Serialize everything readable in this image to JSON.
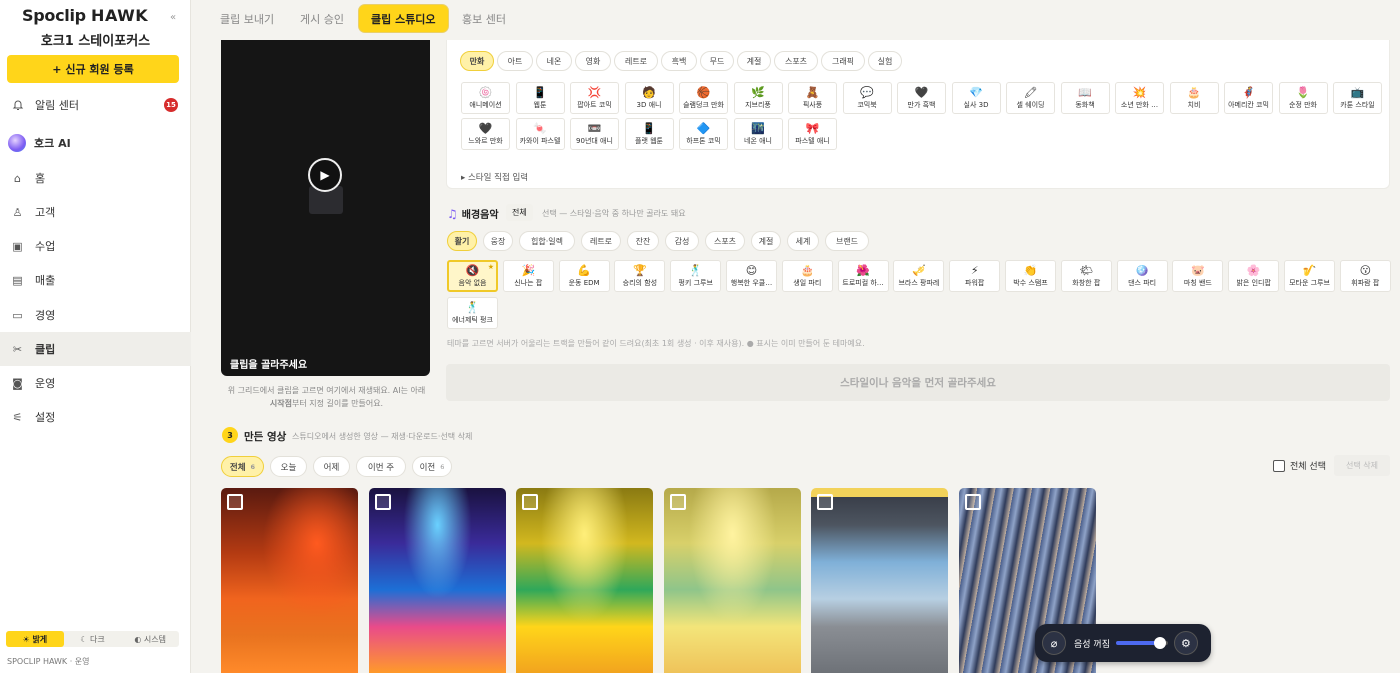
{
  "sidebar": {
    "logo": {
      "part1": "Spoclip ",
      "part2": "HAWK"
    },
    "collapse": "«",
    "org_name": "호크1 스테이포커스",
    "register_button": "+ 신규 회원 등록",
    "notifications": {
      "label": "알림 센터",
      "badge": "15"
    },
    "ai": {
      "label": "호크 AI"
    },
    "items": [
      {
        "label": "홈",
        "icon": "home-icon",
        "glyph": "⌂"
      },
      {
        "label": "고객",
        "icon": "user-icon",
        "glyph": "♙"
      },
      {
        "label": "수업",
        "icon": "calendar-icon",
        "glyph": "▣"
      },
      {
        "label": "매출",
        "icon": "receipt-icon",
        "glyph": "▤"
      },
      {
        "label": "경영",
        "icon": "card-icon",
        "glyph": "▭"
      },
      {
        "label": "클립",
        "icon": "scissors-icon",
        "glyph": "✂"
      },
      {
        "label": "운영",
        "icon": "camera-icon",
        "glyph": "◙"
      },
      {
        "label": "설정",
        "icon": "sliders-icon",
        "glyph": "⚟"
      }
    ],
    "theme": {
      "light": "☀ 밝게",
      "dark": "☾ 다크",
      "system": "◐ 시스템"
    },
    "footer": "SPOCLIP HAWK · 운영"
  },
  "tabs": [
    "클립 보내기",
    "게시 승인",
    "클립 스튜디오",
    "홍보 센터"
  ],
  "video": {
    "caption": "클립을 골라주세요",
    "help_line1": "위 그리드에서 클립을 고르면 여기에서 재생돼요. AI는 아래",
    "help_bold": "시작점",
    "help_line2": "부터 지정 길이를 만들어요."
  },
  "style": {
    "categories": [
      "만화",
      "아트",
      "네온",
      "영화",
      "레트로",
      "흑백",
      "무드",
      "계절",
      "스포츠",
      "그래픽",
      "실험"
    ],
    "cards": [
      {
        "e": "🍥",
        "l": "애니메이션"
      },
      {
        "e": "📱",
        "l": "웹툰"
      },
      {
        "e": "💢",
        "l": "팝아트 코믹"
      },
      {
        "e": "🧑",
        "l": "3D 애니"
      },
      {
        "e": "🏀",
        "l": "슬램덩크 만화"
      },
      {
        "e": "🌿",
        "l": "지브리풍"
      },
      {
        "e": "🧸",
        "l": "픽사풍"
      },
      {
        "e": "💬",
        "l": "코믹북"
      },
      {
        "e": "🖤",
        "l": "만가 흑백"
      },
      {
        "e": "💎",
        "l": "실사 3D"
      },
      {
        "e": "🖍",
        "l": "셀 쉐이딩"
      },
      {
        "e": "📖",
        "l": "동화책"
      },
      {
        "e": "💥",
        "l": "소년 만화 …"
      },
      {
        "e": "🎂",
        "l": "치비"
      },
      {
        "e": "🦸",
        "l": "아메리칸 코믹"
      },
      {
        "e": "🌷",
        "l": "순정 만화"
      },
      {
        "e": "📺",
        "l": "카툰 스타일"
      },
      {
        "e": "🖤",
        "l": "느와르 만화"
      },
      {
        "e": "🍬",
        "l": "카와이 파스텔"
      },
      {
        "e": "📼",
        "l": "90년대 애니"
      },
      {
        "e": "📱",
        "l": "플랫 웹툰"
      },
      {
        "e": "🔷",
        "l": "하프톤 코믹"
      },
      {
        "e": "🌃",
        "l": "네온 애니"
      },
      {
        "e": "🎀",
        "l": "파스텔 애니"
      }
    ],
    "custom_input": "▸ 스타일 직접 입력"
  },
  "music": {
    "title": "배경음악",
    "all_tag": "전체",
    "hint": "선택 — 스타일·음악 중 하나만 골라도 돼요",
    "categories": [
      "활기",
      "웅장",
      "힙합·일렉",
      "레트로",
      "잔잔",
      "감성",
      "스포츠",
      "계절",
      "세계",
      "브랜드"
    ],
    "cards": [
      {
        "e": "🔇",
        "l": "음악 없음"
      },
      {
        "e": "🎉",
        "l": "신나는 팝"
      },
      {
        "e": "💪",
        "l": "운동 EDM"
      },
      {
        "e": "🏆",
        "l": "승리의 함성"
      },
      {
        "e": "🕺",
        "l": "펑키 그루브"
      },
      {
        "e": "😊",
        "l": "행복한 우클…"
      },
      {
        "e": "🎂",
        "l": "생일 파티"
      },
      {
        "e": "🌺",
        "l": "트로피컬 하…"
      },
      {
        "e": "🎺",
        "l": "브라스 팡파레"
      },
      {
        "e": "⚡",
        "l": "파워팝"
      },
      {
        "e": "👏",
        "l": "박수 스탬프"
      },
      {
        "e": "🌤",
        "l": "화창한 팝"
      },
      {
        "e": "🪩",
        "l": "댄스 파티"
      },
      {
        "e": "🐷",
        "l": "마칭 밴드"
      },
      {
        "e": "🌸",
        "l": "밝은 인디팝"
      },
      {
        "e": "🎷",
        "l": "모타운 그루브"
      },
      {
        "e": "😗",
        "l": "휘파람 팝"
      },
      {
        "e": "🕺",
        "l": "에너제틱 펑크"
      }
    ],
    "footnote": "테마를 고르면 서버가 어울리는 트랙을 만들어 같이 드려요(최초 1회 생성 · 이후 재사용). ● 표시는 이미 만들어 둔 테마예요.",
    "generate_button": "스타일이나 음악을 먼저 골라주세요"
  },
  "made": {
    "step": "3",
    "title": "만든 영상",
    "subtitle": "스튜디오에서 생성한 영상 — 재생·다운로드·선택 삭제",
    "filters": [
      {
        "label": "전체",
        "count": "6"
      },
      {
        "label": "오늘",
        "count": ""
      },
      {
        "label": "어제",
        "count": ""
      },
      {
        "label": "이번 주",
        "count": ""
      },
      {
        "label": "이전",
        "count": "6"
      }
    ],
    "select_all": "전체 선택",
    "delete_selected": "선택 삭제"
  },
  "audio": {
    "label": "음성 꺼짐",
    "volume": 0.85
  }
}
